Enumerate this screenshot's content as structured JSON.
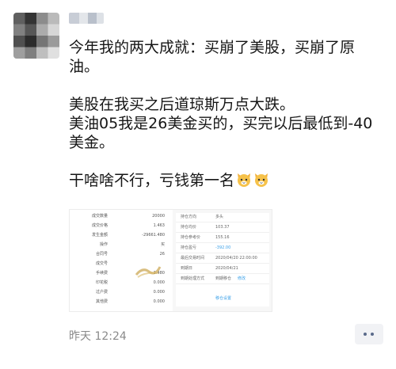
{
  "post": {
    "line1": "今年我的两大成就：买崩了美股，买崩了原油。",
    "line2": "美股在我买之后道琼斯万点大跌。",
    "line3": "美油05我是26美金买的，买完以后最低到-40美金。",
    "line4": "干啥啥不行，亏钱第一名",
    "emoji": [
      "cat-face-icon",
      "cat-face-icon"
    ]
  },
  "trade_screenshot": {
    "left_rows": [
      {
        "label": "成交数量",
        "value": "20000"
      },
      {
        "label": "成交价格",
        "value": "1.463"
      },
      {
        "label": "发生金额",
        "value": "-29661.480"
      },
      {
        "label": "操作",
        "value": "买"
      },
      {
        "label": "合同号",
        "value": "26"
      },
      {
        "label": "成交号",
        "value": ""
      },
      {
        "label": "手续费",
        "value": "1.480"
      },
      {
        "label": "印花税",
        "value": "0.000"
      },
      {
        "label": "过户费",
        "value": "0.000"
      },
      {
        "label": "其他费",
        "value": "0.000"
      }
    ],
    "right_rows": [
      {
        "label": "持仓方向",
        "value": "多头",
        "value2": ""
      },
      {
        "label": "持仓均价",
        "value": "103.37",
        "value2": ""
      },
      {
        "label": "持仓参考价",
        "value": "155.16",
        "value2": ""
      },
      {
        "label": "持仓盈亏",
        "value": "-392.00",
        "value2": ""
      },
      {
        "label": "最后交易时间",
        "value": "2020/04/20 22:00:00",
        "value2": ""
      },
      {
        "label": "到期日",
        "value": "2020/04/21",
        "value2": ""
      },
      {
        "label": "到期处理方式",
        "value": "到期移仓",
        "value2": "修改"
      }
    ],
    "right_button": "移仓设置"
  },
  "footer": {
    "timestamp": "昨天 12:24"
  },
  "colors": {
    "text": "#161616",
    "timestamp": "#8a8a8a",
    "link_blue": "#3aa0e8",
    "more_button_bg": "#f1f2f5"
  }
}
